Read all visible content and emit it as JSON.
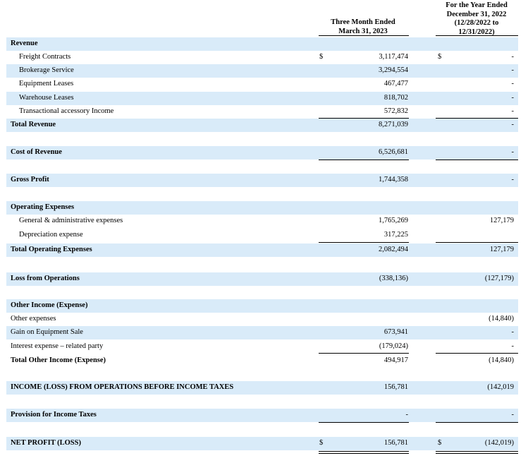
{
  "header": {
    "col1": [
      "Three Month Ended",
      "March 31, 2023"
    ],
    "col2": [
      "For the Year Ended",
      "December 31, 2022",
      "(12/28/2022 to",
      "12/31/2022)"
    ]
  },
  "rows": {
    "revenue": {
      "label": "Revenue"
    },
    "freight": {
      "label": "Freight Contracts",
      "cur1": "$",
      "v1": "3,117,474",
      "cur2": "$",
      "v2": "-"
    },
    "brokerage": {
      "label": "Brokerage Service",
      "v1": "3,294,554",
      "v2": "-"
    },
    "equipment": {
      "label": "Equipment Leases",
      "v1": "467,477",
      "v2": "-"
    },
    "warehouse": {
      "label": "Warehouse Leases",
      "v1": "818,702",
      "v2": "-"
    },
    "transactional": {
      "label": "Transactional accessory Income",
      "v1": "572,832",
      "v2": "-"
    },
    "total_revenue": {
      "label": "Total Revenue",
      "v1": "8,271,039",
      "v2": "-"
    },
    "cost_revenue": {
      "label": "Cost of Revenue",
      "v1": "6,526,681",
      "v2": "-"
    },
    "gross_profit": {
      "label": "Gross Profit",
      "v1": "1,744,358",
      "v2": "-"
    },
    "opex": {
      "label": "Operating Expenses"
    },
    "ga": {
      "label": "General & administrative expenses",
      "v1": "1,765,269",
      "v2": "127,179"
    },
    "depreciation": {
      "label": "Depreciation expense",
      "v1": "317,225"
    },
    "total_opex": {
      "label": "Total Operating Expenses",
      "v1": "2,082,494",
      "v2": "127,179"
    },
    "loss_ops": {
      "label": "Loss from Operations",
      "v1": "(338,136)",
      "v2": "(127,179)"
    },
    "other_income": {
      "label": "Other Income (Expense)"
    },
    "other_expenses": {
      "label": "Other expenses",
      "v2": "(14,840)"
    },
    "gain_equipment": {
      "label": "Gain on Equipment Sale",
      "v1": "673,941",
      "v2": "-"
    },
    "interest": {
      "label": "Interest expense – related party",
      "v1": "(179,024)",
      "v2": "-"
    },
    "total_other": {
      "label": "Total Other Income (Expense)",
      "v1": "494,917",
      "v2": "(14,840)"
    },
    "income_before_tax": {
      "label": "INCOME (LOSS) FROM OPERATIONS BEFORE INCOME TAXES",
      "v1": "156,781",
      "v2": "(142,019"
    },
    "provision": {
      "label": "Provision for Income Taxes",
      "v1": "-",
      "v2": "-"
    },
    "net_profit": {
      "label": "NET PROFIT (LOSS)",
      "cur1": "$",
      "v1": "156,781",
      "cur2": "$",
      "v2": "(142,019)"
    }
  }
}
